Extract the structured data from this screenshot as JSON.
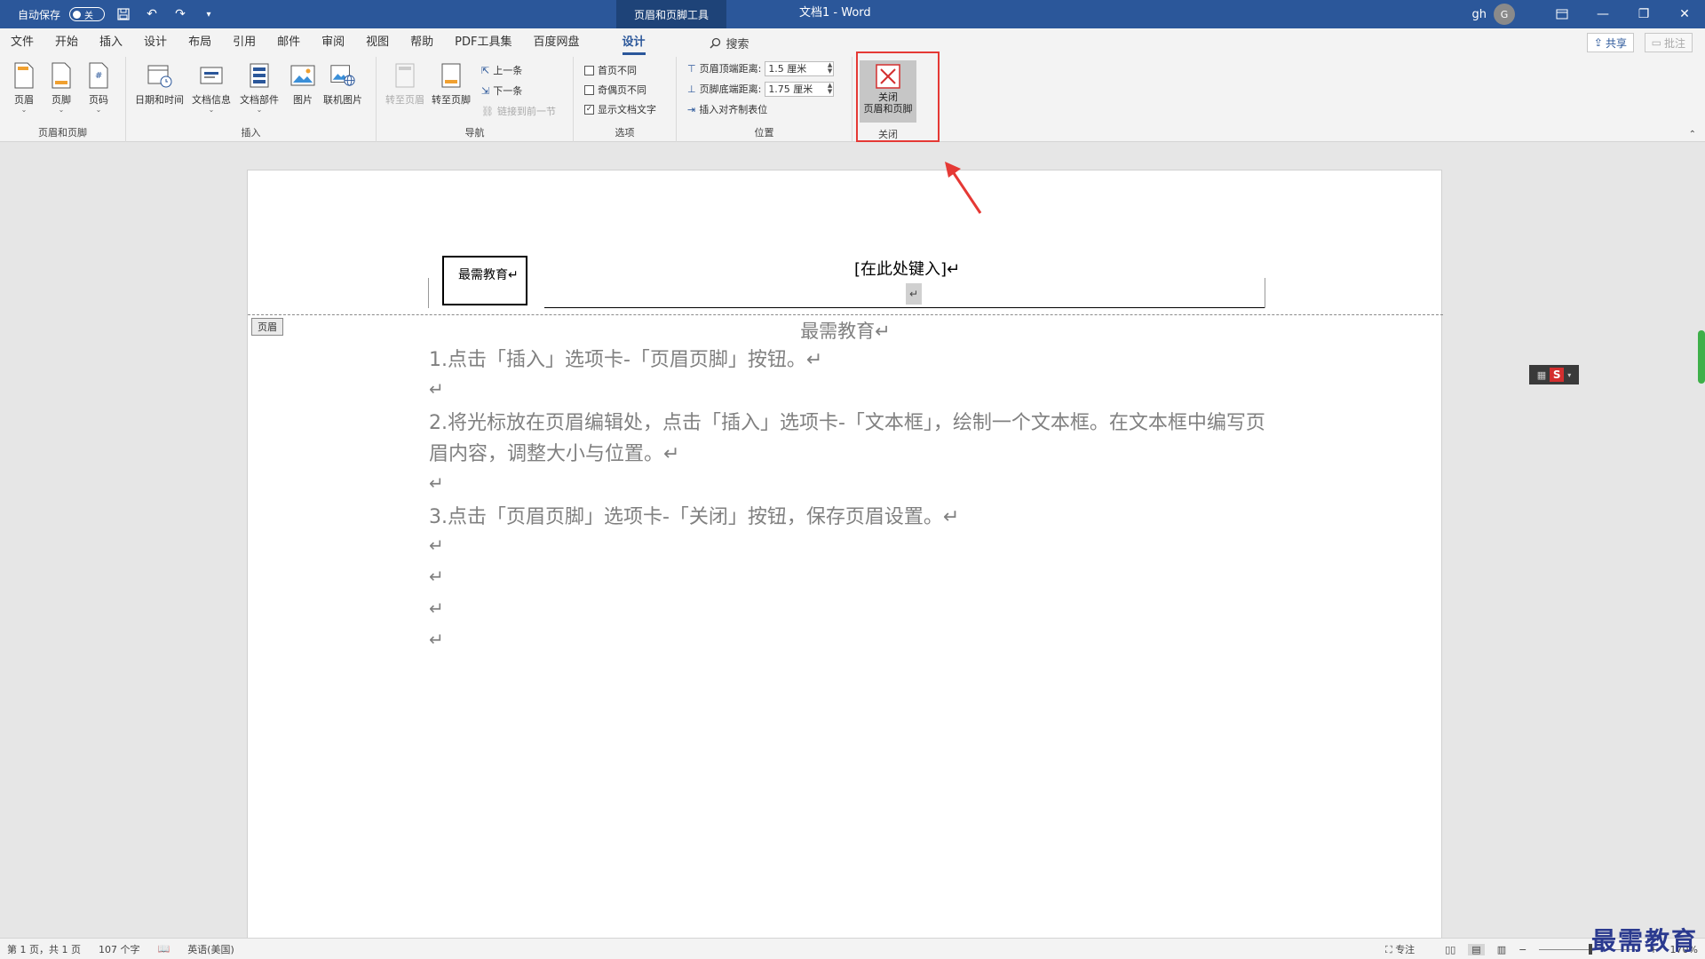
{
  "titlebar": {
    "autosave_label": "自动保存",
    "autosave_state": "关",
    "context_title": "页眉和页脚工具",
    "doc_title": "文档1  -  Word",
    "user_name": "gh",
    "avatar_letter": "G"
  },
  "menu": {
    "tabs": [
      "文件",
      "开始",
      "插入",
      "设计",
      "布局",
      "引用",
      "邮件",
      "审阅",
      "视图",
      "帮助",
      "PDF工具集",
      "百度网盘",
      "设计"
    ],
    "active_index": 12,
    "search_label": "搜索",
    "share_label": "共享",
    "comment_label": "批注"
  },
  "ribbon": {
    "group_hf": {
      "label": "页眉和页脚",
      "header": "页眉",
      "footer": "页脚",
      "page_number": "页码"
    },
    "group_insert": {
      "label": "插入",
      "date_time": "日期和时间",
      "doc_info": "文档信息",
      "doc_parts": "文档部件",
      "picture": "图片",
      "online_picture": "联机图片"
    },
    "group_nav": {
      "label": "导航",
      "goto_header": "转至页眉",
      "goto_footer": "转至页脚",
      "previous": "上一条",
      "next": "下一条",
      "link_previous": "链接到前一节"
    },
    "group_options": {
      "label": "选项",
      "first_page": "首页不同",
      "odd_even": "奇偶页不同",
      "show_text": "显示文档文字"
    },
    "group_position": {
      "label": "位置",
      "header_top": "页眉顶端距离:",
      "header_top_value": "1.5 厘米",
      "footer_bottom": "页脚底端距离:",
      "footer_bottom_value": "1.75 厘米",
      "insert_tab": "插入对齐制表位"
    },
    "group_close": {
      "label": "关闭",
      "close_line1": "关闭",
      "close_line2": "页眉和页脚"
    }
  },
  "document": {
    "header_textbox": "最需教育↵",
    "header_placeholder": "[在此处键入]↵",
    "cursor_mark": "↵",
    "header_tag": "页眉",
    "body_title": "最需教育↵",
    "para1": "1.点击「插入」选项卡-「页眉页脚」按钮。↵",
    "para2": "2.将光标放在页眉编辑处，点击「插入」选项卡-「文本框」，绘制一个文本框。在文本框中编写页眉内容，调整大小与位置。↵",
    "para3": "3.点击「页眉页脚」选项卡-「关闭」按钮，保存页眉设置。↵",
    "empty_mark": "↵",
    "ime_letter": "S"
  },
  "status": {
    "page": "第 1 页，共 1 页",
    "words": "107 个字",
    "language": "英语(美国)",
    "focus": "专注",
    "zoom": "170%"
  },
  "watermark": "最需教育",
  "colors": {
    "brand": "#2b579a",
    "highlight": "#e53935"
  }
}
